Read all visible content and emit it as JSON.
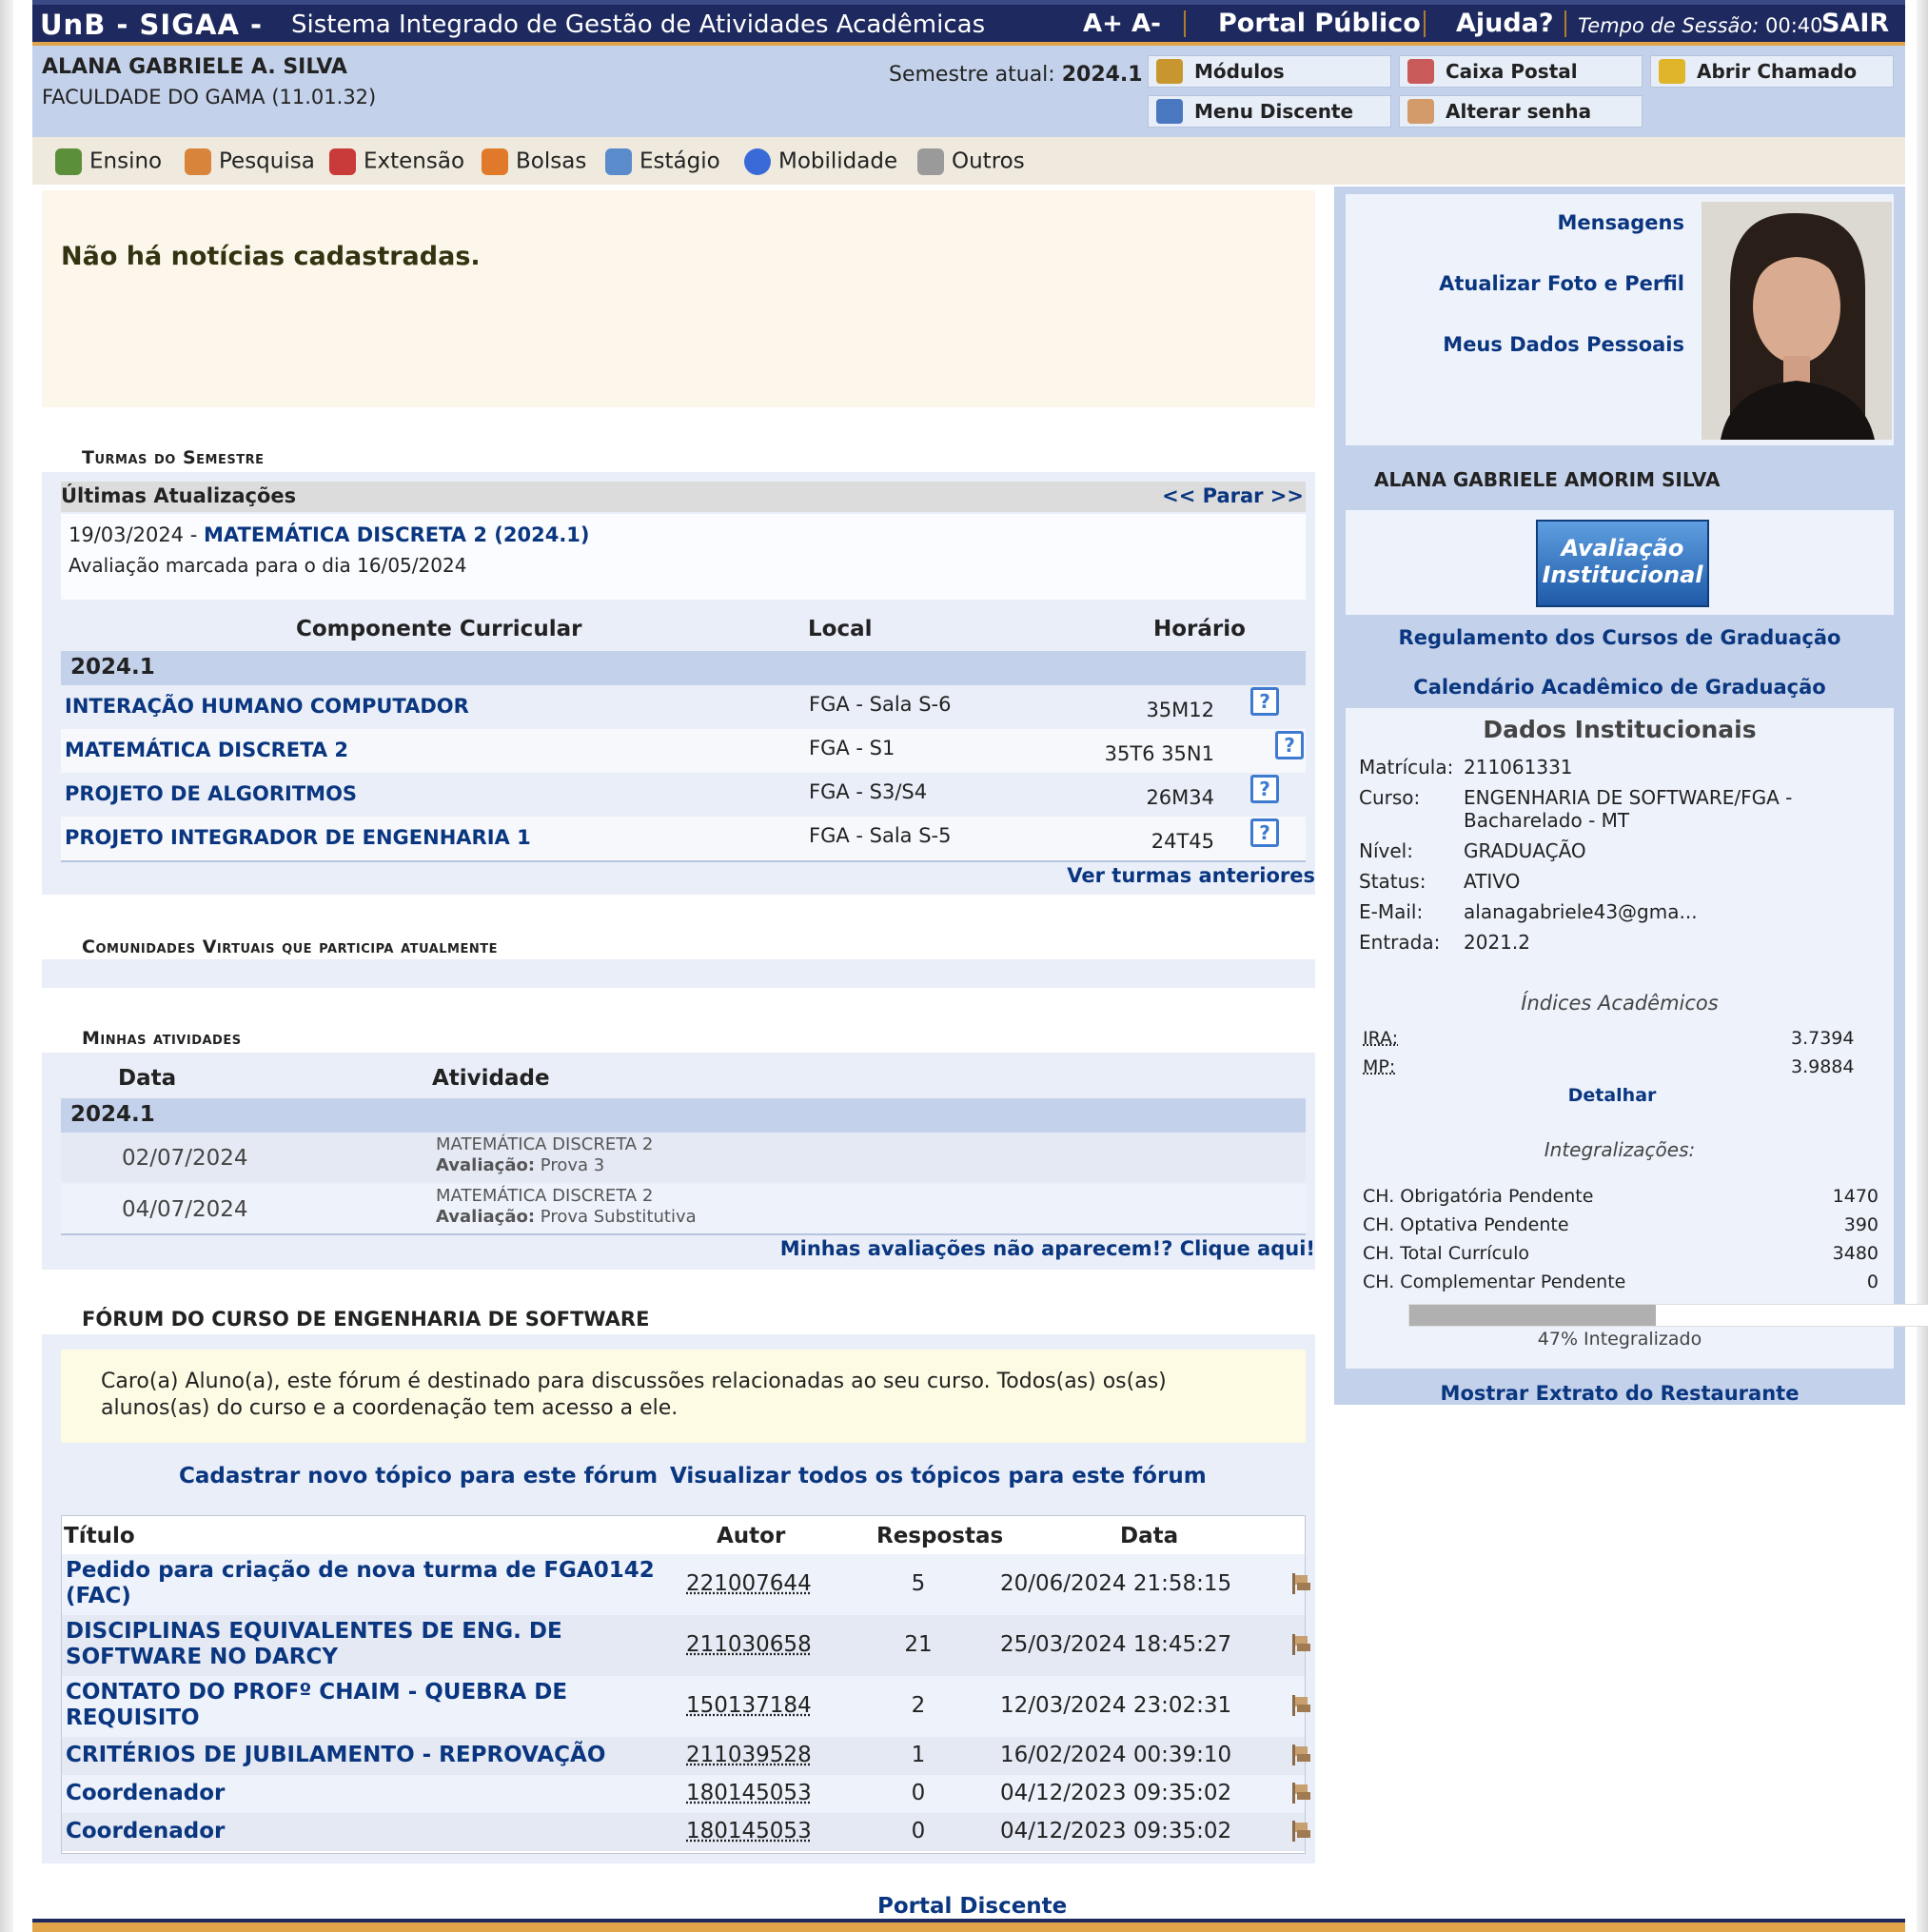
{
  "topbar": {
    "brand": "UnB - SIGAA -",
    "system_name": "Sistema Integrado de Gestão de Atividades Acadêmicas",
    "font_increase": "A+",
    "font_decrease": "A-",
    "public_portal": "Portal Público",
    "help": "Ajuda?",
    "session_label": "Tempo de Sessão:",
    "session_time": "00:40",
    "logout": "SAIR"
  },
  "user_bar": {
    "name": "ALANA GABRIELE A. SILVA",
    "unit": "FACULDADE DO GAMA (11.01.32)",
    "semester_label": "Semestre atual:",
    "semester_value": "2024.1",
    "buttons": {
      "modules": "Módulos",
      "mailbox": "Caixa Postal",
      "ticket": "Abrir Chamado",
      "student_menu": "Menu Discente",
      "change_password": "Alterar senha"
    }
  },
  "menu": {
    "ensino": "Ensino",
    "pesquisa": "Pesquisa",
    "extensao": "Extensão",
    "bolsas": "Bolsas",
    "estagio": "Estágio",
    "mobilidade": "Mobilidade",
    "outros": "Outros"
  },
  "news": {
    "message": "Não há notícias cadastradas."
  },
  "classes": {
    "section_title": "Turmas do Semestre",
    "updates_title": "Últimas Atualizações",
    "stop_control": "<< Parar >>",
    "update_date": "19/03/2024 -",
    "update_link": "MATEMÁTICA DISCRETA 2 (2024.1)",
    "update_text": "Avaliação marcada para o dia 16/05/2024",
    "col_component": "Componente Curricular",
    "col_location": "Local",
    "col_schedule": "Horário",
    "group": "2024.1",
    "rows": [
      {
        "component": "INTERAÇÃO HUMANO COMPUTADOR",
        "location": "FGA - Sala S-6",
        "schedule": "35M12"
      },
      {
        "component": "MATEMÁTICA DISCRETA 2",
        "location": "FGA - S1",
        "schedule": "35T6 35N1"
      },
      {
        "component": "PROJETO DE ALGORITMOS",
        "location": "FGA - S3/S4",
        "schedule": "26M34"
      },
      {
        "component": "PROJETO INTEGRADOR DE ENGENHARIA 1",
        "location": "FGA - Sala S-5",
        "schedule": "24T45"
      }
    ],
    "help_glyph": "?",
    "previous_link": "Ver turmas anteriores"
  },
  "communities": {
    "section_title": "Comunidades Virtuais que participa atualmente"
  },
  "activities": {
    "section_title": "Minhas atividades",
    "col_date": "Data",
    "col_activity": "Atividade",
    "group": "2024.1",
    "eval_label": "Avaliação:",
    "rows": [
      {
        "date": "02/07/2024",
        "course": "MATEMÁTICA DISCRETA 2",
        "eval": "Prova 3"
      },
      {
        "date": "04/07/2024",
        "course": "MATEMÁTICA DISCRETA 2",
        "eval": "Prova Substitutiva"
      }
    ],
    "missing_link": "Minhas avaliações não aparecem!? Clique aqui!"
  },
  "forum": {
    "section_title": "FÓRUM DO CURSO DE ENGENHARIA DE SOFTWARE",
    "note": "Caro(a) Aluno(a), este fórum é destinado para discussões relacionadas ao seu curso. Todos(as) os(as) alunos(as) do curso e a coordenação tem acesso a ele.",
    "new_topic": "Cadastrar novo tópico para este fórum",
    "view_all": "Visualizar todos os tópicos para este fórum",
    "col_title": "Título",
    "col_author": "Autor",
    "col_replies": "Respostas",
    "col_date": "Data",
    "rows": [
      {
        "title": "Pedido para criação de nova turma de FGA0142 (FAC)",
        "author": "221007644",
        "replies": "5",
        "date": "20/06/2024 21:58:15"
      },
      {
        "title": "DISCIPLINAS EQUIVALENTES DE ENG. DE SOFTWARE NO DARCY",
        "author": "211030658",
        "replies": "21",
        "date": "25/03/2024 18:45:27"
      },
      {
        "title": "CONTATO DO PROFº CHAIM - QUEBRA DE REQUISITO",
        "author": "150137184",
        "replies": "2",
        "date": "12/03/2024 23:02:31"
      },
      {
        "title": "CRITÉRIOS DE JUBILAMENTO - REPROVAÇÃO",
        "author": "211039528",
        "replies": "1",
        "date": "16/02/2024 00:39:10"
      },
      {
        "title": "Coordenador",
        "author": "180145053",
        "replies": "0",
        "date": "04/12/2023 09:35:02"
      },
      {
        "title": "Coordenador",
        "author": "180145053",
        "replies": "0",
        "date": "04/12/2023 09:35:02"
      }
    ]
  },
  "footer": {
    "portal_link": "Portal Discente"
  },
  "profile": {
    "messages": "Mensagens",
    "update_photo": "Atualizar Foto e Perfil",
    "personal_data": "Meus Dados Pessoais",
    "full_name": "ALANA GABRIELE AMORIM SILVA",
    "eval_banner_line1": "Avaliação",
    "eval_banner_line2": "Institucional",
    "regulation_link": "Regulamento dos Cursos de Graduação",
    "calendar_link": "Calendário Acadêmico de Graduação"
  },
  "institutional": {
    "title": "Dados Institucionais",
    "fields": [
      {
        "label": "Matrícula:",
        "value": "211061331"
      },
      {
        "label": "Curso:",
        "value": "ENGENHARIA DE SOFTWARE/FGA - Bacharelado - MT"
      },
      {
        "label": "Nível:",
        "value": "GRADUAÇÃO"
      },
      {
        "label": "Status:",
        "value": "ATIVO"
      },
      {
        "label": "E-Mail:",
        "value": "alanagabriele43@gma..."
      },
      {
        "label": "Entrada:",
        "value": "2021.2"
      }
    ],
    "indices_title": "Índices Acadêmicos",
    "ira_label": "IRA:",
    "ira_value": "3.7394",
    "mp_label": "MP:",
    "mp_value": "3.9884",
    "detail_link": "Detalhar",
    "integ_title": "Integralizações:",
    "integ_rows": [
      {
        "label": "CH. Obrigatória Pendente",
        "value": "1470"
      },
      {
        "label": "CH. Optativa Pendente",
        "value": "390"
      },
      {
        "label": "CH. Total Currículo",
        "value": "3480"
      },
      {
        "label": "CH. Complementar Pendente",
        "value": "0"
      }
    ],
    "progress_fraction": 0.47,
    "progress_text": "47% Integralizado",
    "restaurant_link": "Mostrar Extrato do Restaurante"
  },
  "colors": {
    "navy": "#1e2a5f",
    "link": "#0a3680",
    "accent": "#e2a449",
    "panel": "#e9eef8",
    "group": "#c3d1ea"
  }
}
